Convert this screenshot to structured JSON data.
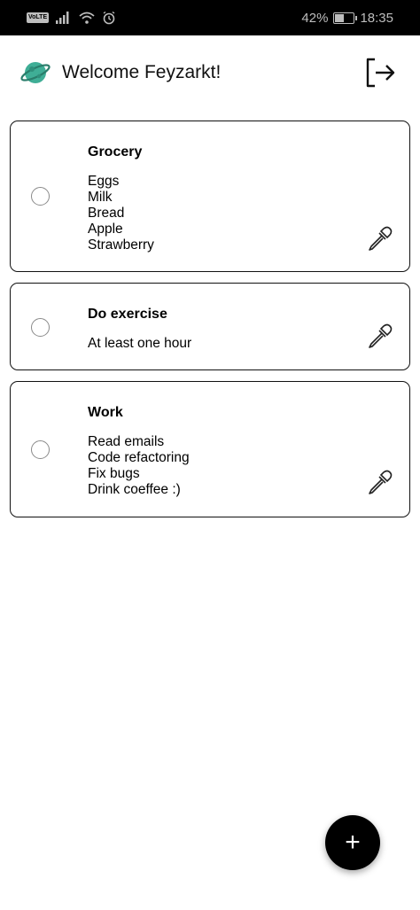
{
  "status_bar": {
    "volte": "VoLTE",
    "battery": "42%",
    "battery_level": 0.42,
    "time": "18:35"
  },
  "header": {
    "welcome": "Welcome Feyzarkt!",
    "logo_icon": "planet-icon",
    "logout_icon": "logout-icon"
  },
  "todos": [
    {
      "title": "Grocery",
      "lines": [
        "Eggs",
        "Milk",
        "Bread",
        "Apple",
        "Strawberry"
      ],
      "completed": false
    },
    {
      "title": "Do exercise",
      "lines": [
        "At least one hour"
      ],
      "completed": false
    },
    {
      "title": "Work",
      "lines": [
        "Read emails",
        "Code refactoring",
        "Fix bugs",
        "Drink coeffee :)"
      ],
      "completed": false
    }
  ],
  "fab": {
    "label": "+"
  },
  "colors": {
    "planet": "#3fae96",
    "status_bar_bg": "#000000",
    "fab_bg": "#000000"
  }
}
